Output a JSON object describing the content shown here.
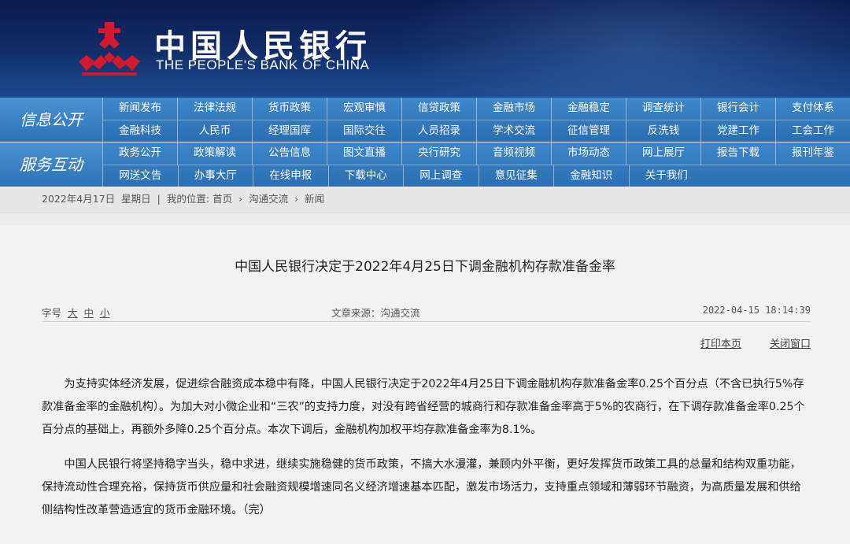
{
  "header": {
    "name_cn": "中国人民银行",
    "name_en": "THE PEOPLE'S BANK OF CHINA",
    "logo_icon": "pboc-logo-icon",
    "brand_color": "#c8102e"
  },
  "nav": {
    "section1_title": "信息公开",
    "section1_row1": [
      "新闻发布",
      "法律法规",
      "货币政策",
      "宏观审慎",
      "信贷政策",
      "金融市场",
      "金融稳定",
      "调查统计",
      "银行会计",
      "支付体系"
    ],
    "section1_row2": [
      "金融科技",
      "人民币",
      "经理国库",
      "国际交往",
      "人员招录",
      "学术交流",
      "征信管理",
      "反洗钱",
      "党建工作",
      "工会工作"
    ],
    "section2_title": "服务互动",
    "section2_row1": [
      "政务公开",
      "政策解读",
      "公告信息",
      "图文直播",
      "央行研究",
      "音频视频",
      "市场动态",
      "网上展厅",
      "报告下载",
      "报刊年鉴"
    ],
    "section2_row2": [
      "网送文告",
      "办事大厅",
      "在线申报",
      "下载中心",
      "网上调查",
      "意见征集",
      "金融知识",
      "关于我们"
    ]
  },
  "breadcrumb": {
    "date": "2022年4月17日",
    "weekday": "星期日",
    "sep": "|",
    "location_label": "我的位置:",
    "items": [
      "首页",
      "沟通交流",
      "新闻"
    ]
  },
  "article": {
    "title": "中国人民银行决定于2022年4月25日下调金融机构存款准备金率",
    "font_size_label": "字号",
    "font_sizes": [
      "大",
      "中",
      "小"
    ],
    "source": "文章来源：沟通交流",
    "datetime": "2022-04-15 18:14:39",
    "print_label": "打印本页",
    "close_label": "关闭窗口",
    "paragraphs": [
      "为支持实体经济发展，促进综合融资成本稳中有降，中国人民银行决定于2022年4月25日下调金融机构存款准备金率0.25个百分点（不含已执行5%存款准备金率的金融机构）。为加大对小微企业和“三农”的支持力度，对没有跨省经营的城商行和存款准备金率高于5%的农商行，在下调存款准备金率0.25个百分点的基础上，再额外多降0.25个百分点。本次下调后，金融机构加权平均存款准备金率为8.1%。",
      "中国人民银行将坚持稳字当头，稳中求进，继续实施稳健的货币政策，不搞大水漫灌，兼顾内外平衡，更好发挥货币政策工具的总量和结构双重功能，保持流动性合理充裕，保持货币供应量和社会融资规模增速同名义经济增速基本匹配，激发市场活力，支持重点领域和薄弱环节融资，为高质量发展和供给侧结构性改革营造适宜的货币金融环境。（完）"
    ]
  }
}
